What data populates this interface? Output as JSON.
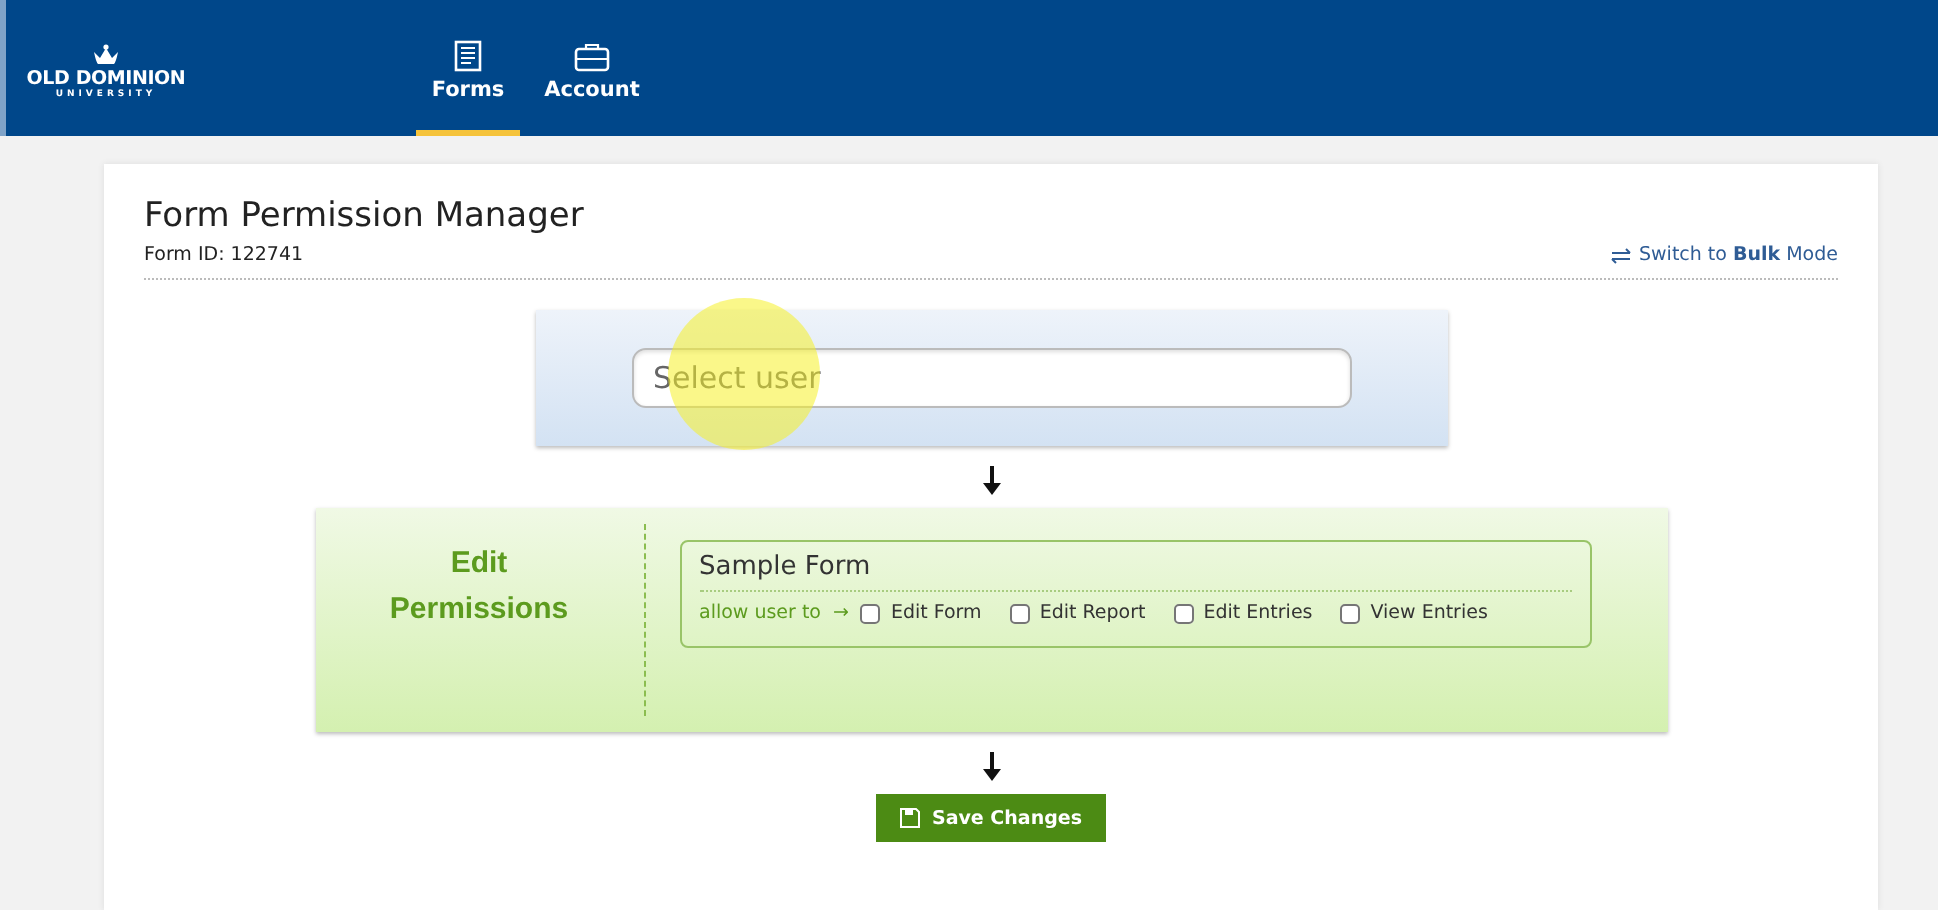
{
  "header": {
    "logo": {
      "name": "OLD DOMINION",
      "sub": "UNIVERSITY"
    },
    "tabs": [
      {
        "label": "Forms",
        "kind": "forms",
        "selected": true
      },
      {
        "label": "Account",
        "kind": "account",
        "selected": false
      }
    ]
  },
  "page": {
    "title": "Form Permission Manager",
    "form_id": "Form ID: 122741",
    "switch_link": "Switch to **Bulk** Mode"
  },
  "user_select": {
    "placeholder": "Select user"
  },
  "permissions": {
    "heading": "Edit Permissions",
    "form_name": "Sample Form",
    "prompt": "allow user to",
    "prompt_arrow": "→",
    "options": [
      {
        "label": "Edit Form",
        "checked": false
      },
      {
        "label": "Edit Report",
        "checked": false
      },
      {
        "label": "Edit Entries",
        "checked": false
      },
      {
        "label": "View Entries",
        "checked": false
      }
    ]
  },
  "save_button": {
    "label": "Save Changes"
  }
}
